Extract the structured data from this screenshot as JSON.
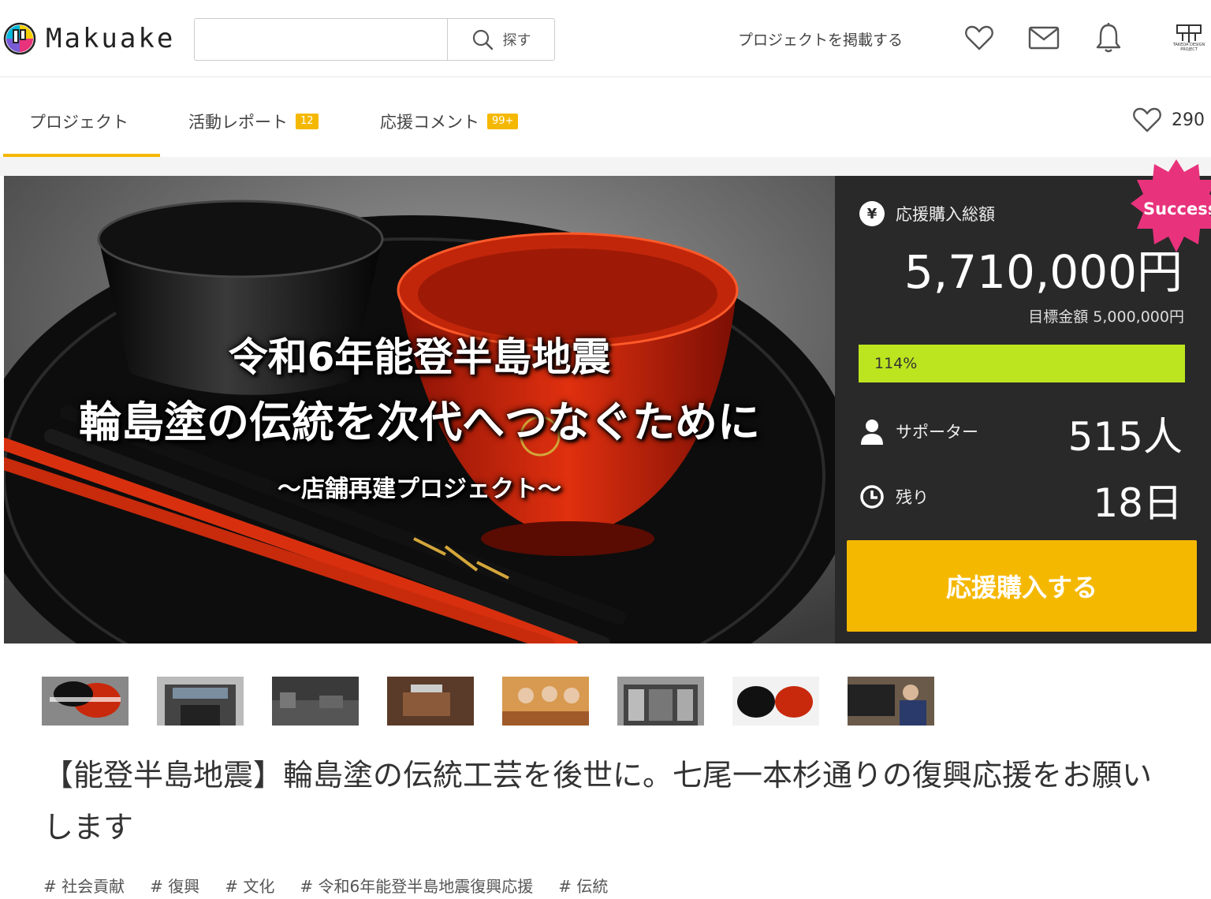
{
  "header": {
    "logo_text": "Makuake",
    "search_placeholder": "",
    "search_button": "探す",
    "post_project": "プロジェクトを掲載する",
    "icons": [
      "heart-icon",
      "mail-icon",
      "bell-icon"
    ],
    "brand_logo_text": "TAKEDA DESIGN PROJECT"
  },
  "tabs": {
    "project": "プロジェクト",
    "reports": "活動レポート",
    "reports_badge": "12",
    "comments": "応援コメント",
    "comments_badge": "99+",
    "favorite_count": "290"
  },
  "hero": {
    "line1": "令和6年能登半島地震",
    "line2": "輪島塗の伝統を次代へつなぐために",
    "line3": "〜店舗再建プロジェクト〜"
  },
  "stats": {
    "total_label": "応援購入総額",
    "total_amount": "5,710,000円",
    "target": "目標金額 5,000,000円",
    "progress_text": "114%",
    "progress_fraction": 1.0,
    "supporters_label": "サポーター",
    "supporters": "515人",
    "remaining_label": "残り",
    "remaining": "18日",
    "buy_button": "応援購入する",
    "success_badge": "Success"
  },
  "thumbnails": 8,
  "title": "【能登半島地震】輪島塗の伝統工芸を後世に。七尾一本杉通りの復興応援をお願いします",
  "tags": [
    "社会貢献",
    "復興",
    "文化",
    "令和6年能登半島地震復興応援",
    "伝統"
  ],
  "colors": {
    "accent": "#f5b800",
    "progress": "#bde51f",
    "panel": "#292929"
  }
}
